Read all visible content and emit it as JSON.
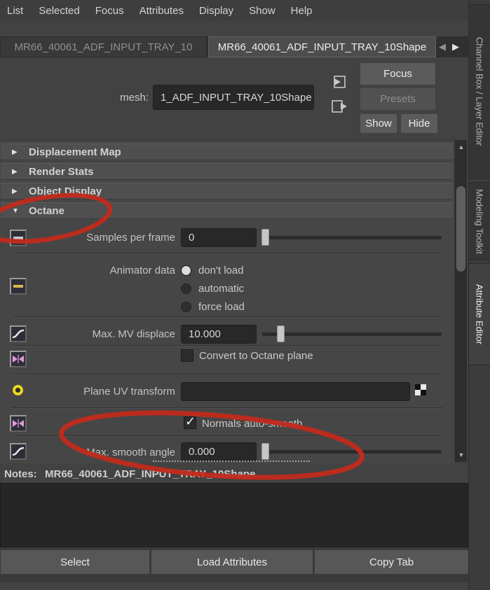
{
  "menu": {
    "items": [
      "List",
      "Selected",
      "Focus",
      "Attributes",
      "Display",
      "Show",
      "Help"
    ]
  },
  "tabs": {
    "inactive": "MR66_40061_ADF_INPUT_TRAY_10",
    "active": "MR66_40061_ADF_INPUT_TRAY_10Shape"
  },
  "glyphs": {
    "prev": "◀",
    "next": "▶",
    "up": "▲",
    "down": "▼",
    "collapsed": "▶",
    "expanded": "▼",
    "check": "✓"
  },
  "header": {
    "mesh_label": "mesh:",
    "mesh_value": "1_ADF_INPUT_TRAY_10Shape",
    "focus": "Focus",
    "presets": "Presets",
    "show": "Show",
    "hide": "Hide"
  },
  "sections": [
    {
      "label": "Displacement Map",
      "arrow": "▶"
    },
    {
      "label": "Render Stats",
      "arrow": "▶"
    },
    {
      "label": "Object Display",
      "arrow": "▶"
    },
    {
      "label": "Octane",
      "arrow": "▼"
    }
  ],
  "octane": {
    "samples_per_frame": {
      "label": "Samples per frame",
      "value": "0"
    },
    "animator_data": {
      "label": "Animator data",
      "options": [
        {
          "label": "don't load",
          "selected": true
        },
        {
          "label": "automatic",
          "selected": false
        },
        {
          "label": "force load",
          "selected": false
        }
      ]
    },
    "max_mv_displace": {
      "label": "Max. MV displace",
      "value": "10.000"
    },
    "convert_plane": {
      "label": "Convert to Octane plane",
      "checked": false
    },
    "plane_uv": {
      "label": "Plane UV transform",
      "value": ""
    },
    "normals_auto_smooth": {
      "label": "Normals auto-smooth",
      "checked": true
    },
    "max_smooth_angle": {
      "label": "Max. smooth angle",
      "value": "0.000"
    }
  },
  "notes": {
    "label": "Notes:",
    "value": "MR66_40061_ADF_INPUT_TRAY_10Shape",
    "content": ""
  },
  "footer": {
    "buttons": [
      "Select",
      "Load Attributes",
      "Copy Tab"
    ]
  },
  "sidebar": {
    "tabs": [
      {
        "label": "Channel Box / Layer Editor",
        "active": false
      },
      {
        "label": "Modeling Toolkit",
        "active": false
      },
      {
        "label": "Attribute Editor",
        "active": true
      }
    ]
  },
  "colors": {
    "annotation_red": "#c22b1c",
    "accent_yellow": "#e8da1e"
  }
}
